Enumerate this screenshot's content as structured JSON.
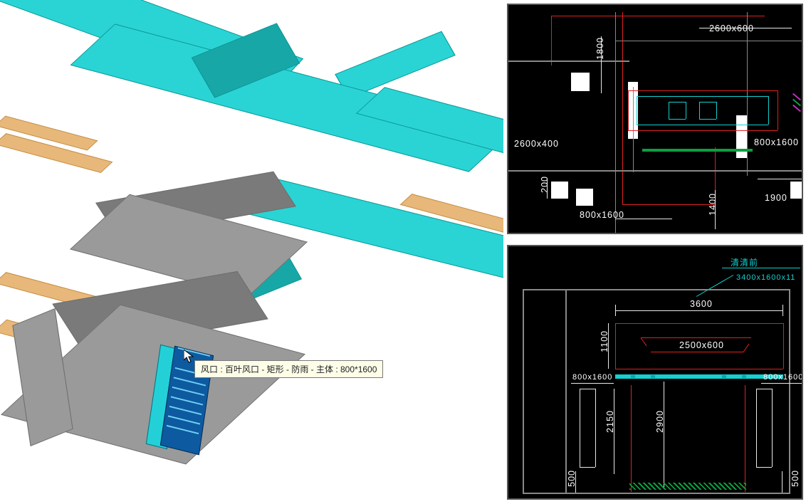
{
  "tooltip": {
    "text": "风口 : 百叶风口 - 矩形 - 防雨 - 主体 : 800*1600"
  },
  "cad_top": {
    "labels": {
      "dim_2600x600": "2600x600",
      "dim_2600x400": "2600x400",
      "dim_800x1600_a": "800x1600",
      "dim_800x1600_b": "800x1600",
      "dim_1800": "1800",
      "dim_200": "200",
      "dim_1400": "1400",
      "dim_1900": "1900"
    }
  },
  "cad_bot": {
    "labels": {
      "note_right": "清清前",
      "dim_3400x1600x11": "3400x1600x11",
      "dim_3600": "3600",
      "dim_2500x600": "2500x600",
      "dim_1100": "1100",
      "dim_800x1600_l": "800x1600",
      "dim_800x1600_r": "800x1600",
      "dim_2150": "2150",
      "dim_2900": "2900",
      "dim_500_l": "500",
      "dim_500_r": "500"
    }
  }
}
